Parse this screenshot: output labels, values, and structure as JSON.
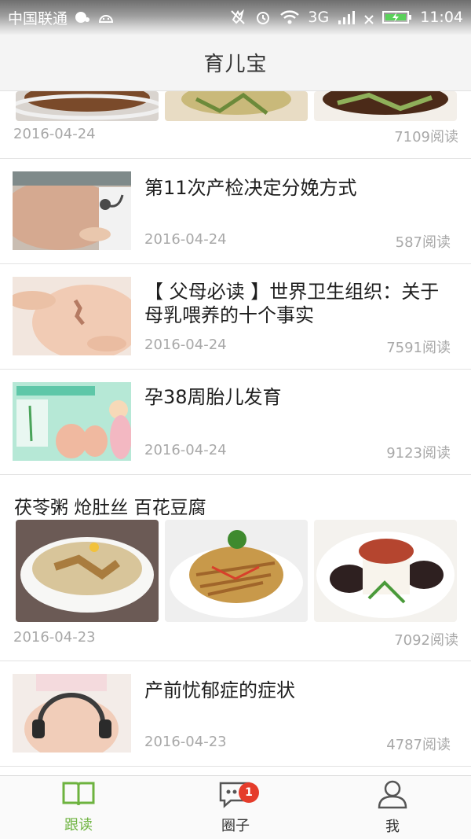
{
  "status_bar": {
    "carrier": "中国联通",
    "network": "3G",
    "time": "11:04"
  },
  "header": {
    "title": "育儿宝"
  },
  "feed": {
    "partial_card": {
      "date": "2016-04-24",
      "reads": "7109阅读"
    },
    "articles": [
      {
        "title": "第11次产检决定分娩方式",
        "date": "2016-04-24",
        "reads": "587阅读"
      },
      {
        "title": "【 父母必读 】世界卫生组织：关于母乳喂养的十个事实",
        "date": "2016-04-24",
        "reads": "7591阅读"
      },
      {
        "title": "孕38周胎儿发育",
        "date": "2016-04-24",
        "reads": "9123阅读"
      }
    ],
    "recipe_card": {
      "title": "茯苓粥  炝肚丝  百花豆腐",
      "date": "2016-04-23",
      "reads": "7092阅读"
    },
    "last_article": {
      "title": "产前忧郁症的症状",
      "date": "2016-04-23",
      "reads": "4787阅读"
    }
  },
  "bottom_nav": {
    "items": [
      {
        "label": "跟读",
        "icon": "book-icon",
        "active": true
      },
      {
        "label": "圈子",
        "icon": "chat-bubble-icon",
        "badge": "1"
      },
      {
        "label": "我",
        "icon": "person-icon"
      }
    ]
  },
  "colors": {
    "accent": "#6db33f",
    "badge": "#e53c2b",
    "meta_text": "#a8a8a8"
  }
}
